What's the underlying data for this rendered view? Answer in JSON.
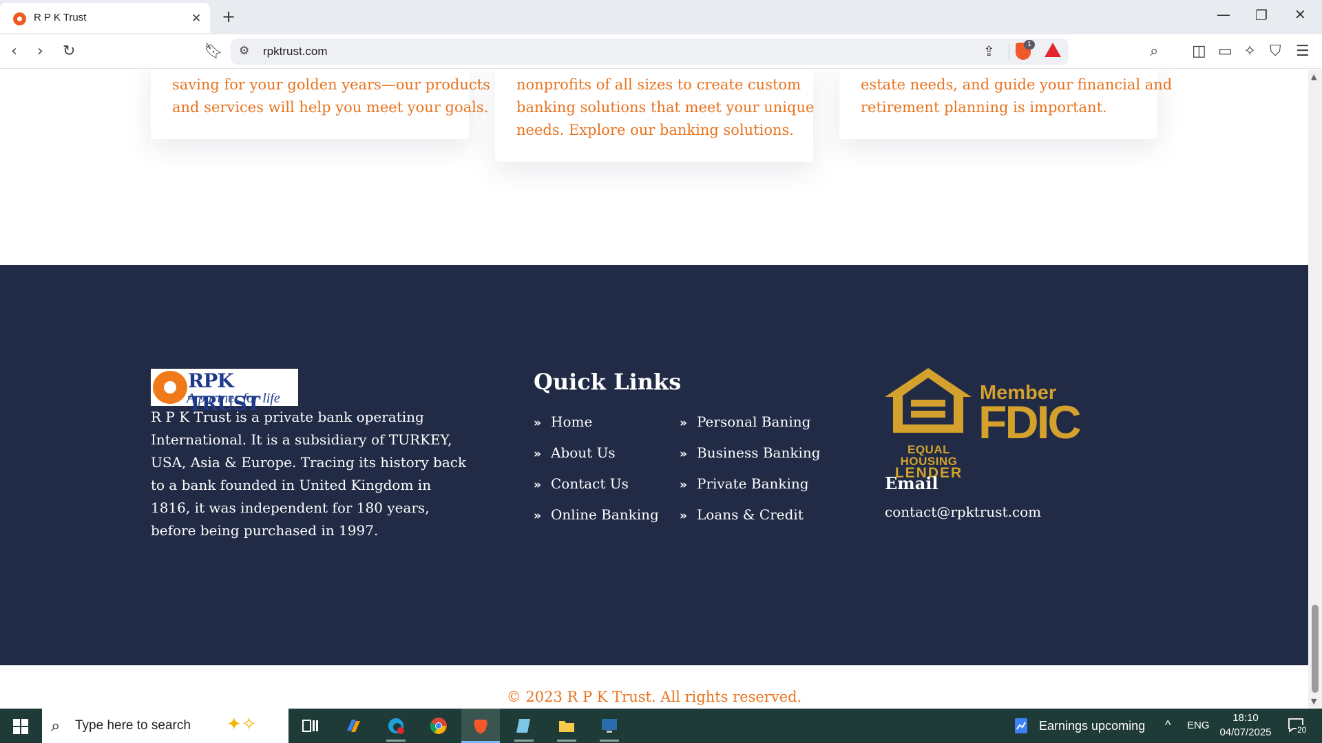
{
  "browser": {
    "tab_title": "R P K Trust",
    "url": "rpktrust.com",
    "shield_count": "1"
  },
  "cards": [
    {
      "lines": [
        "saving for your golden years—our products",
        "and services will help you meet your goals."
      ]
    },
    {
      "lines": [
        "nonprofits of all sizes to create custom",
        "banking solutions that meet your unique",
        "needs. Explore our banking solutions."
      ]
    },
    {
      "lines": [
        "estate needs, and guide your financial and",
        "retirement planning is important."
      ]
    }
  ],
  "footer": {
    "logo": {
      "name": "RPK TRUST",
      "tagline": "A partner for life"
    },
    "about": "R P K Trust is a private bank operating International. It is a subsidiary of TURKEY, USA, Asia & Europe. Tracing its history back to a bank founded in United Kingdom in 1816, it was independent for 180 years, before being purchased in 1997.",
    "quick_links": {
      "title": "Quick Links",
      "col1": [
        "Home",
        "About Us",
        "Contact Us",
        "Online Banking"
      ],
      "col2": [
        "Personal Baning",
        "Business Banking",
        "Private Banking",
        "Loans & Credit"
      ]
    },
    "fdic": {
      "ehl_line1": "EQUAL HOUSING",
      "ehl_line2": "LENDER",
      "member": "Member",
      "fdic": "FDIC"
    },
    "email": {
      "title": "Email",
      "value": "contact@rpktrust.com"
    }
  },
  "copyright": "© 2023 R P K Trust. All rights reserved.",
  "taskbar": {
    "search_placeholder": "Type here to search",
    "news": "Earnings upcoming",
    "lang": "ENG",
    "time": "18:10",
    "date": "04/07/2025",
    "notifications": "20"
  }
}
